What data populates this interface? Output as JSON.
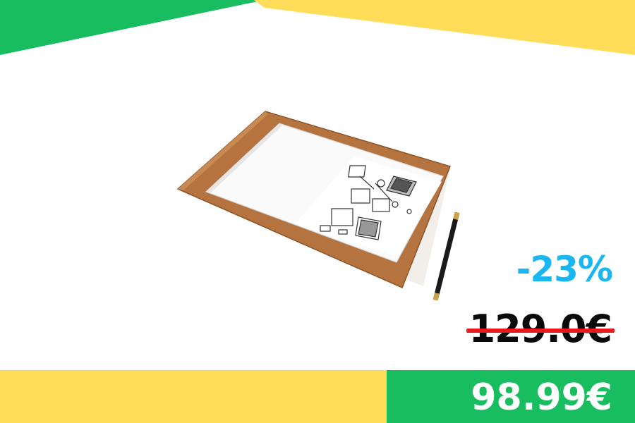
{
  "colors": {
    "green": "#17bd5f",
    "yellow": "#ffdd59",
    "discount": "#1ab6f2",
    "strike": "#e8191b",
    "background": "#ffffff"
  },
  "product": {
    "icon": "sketch-notebook-with-pen-image"
  },
  "price": {
    "discount": "-23%",
    "old": "129.0€",
    "new": "98.99€"
  }
}
